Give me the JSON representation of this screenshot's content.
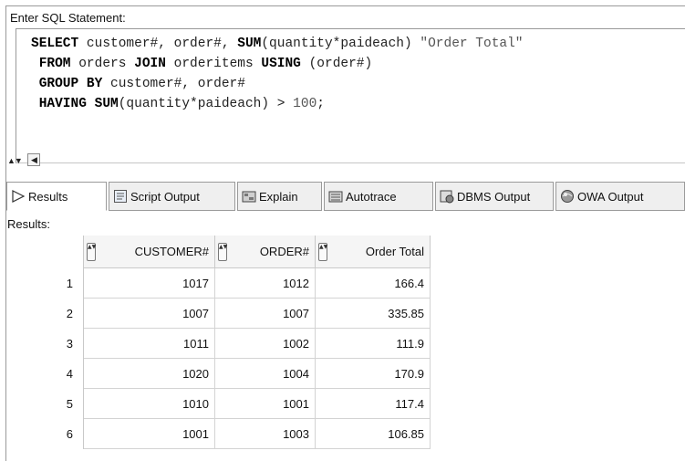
{
  "sql_panel": {
    "label": "Enter SQL Statement:",
    "lines": [
      [
        {
          "t": "SELECT",
          "k": 1
        },
        {
          "t": " customer#, order#, "
        },
        {
          "t": "SUM",
          "k": 1
        },
        {
          "t": "(quantity*paideach) "
        },
        {
          "t": "\"Order Total\"",
          "s": 1
        }
      ],
      [
        {
          "t": " "
        },
        {
          "t": "FROM",
          "k": 1
        },
        {
          "t": " orders "
        },
        {
          "t": "JOIN",
          "k": 1
        },
        {
          "t": " orderitems "
        },
        {
          "t": "USING",
          "k": 1
        },
        {
          "t": " (order#)"
        }
      ],
      [
        {
          "t": " "
        },
        {
          "t": "GROUP BY",
          "k": 1
        },
        {
          "t": " customer#, order#"
        }
      ],
      [
        {
          "t": " "
        },
        {
          "t": "HAVING",
          "k": 1
        },
        {
          "t": " "
        },
        {
          "t": "SUM",
          "k": 1
        },
        {
          "t": "(quantity*paideach) > "
        },
        {
          "t": "100",
          "s": 1
        },
        {
          "t": ";"
        }
      ]
    ]
  },
  "tabs": [
    {
      "label": "Results",
      "icon": "results-triangle-icon",
      "active": true
    },
    {
      "label": "Script Output",
      "icon": "script-output-icon"
    },
    {
      "label": "Explain",
      "icon": "explain-icon"
    },
    {
      "label": "Autotrace",
      "icon": "autotrace-icon"
    },
    {
      "label": "DBMS Output",
      "icon": "dbms-output-icon"
    },
    {
      "label": "OWA Output",
      "icon": "owa-output-icon"
    }
  ],
  "results": {
    "label": "Results:",
    "columns": [
      "CUSTOMER#",
      "ORDER#",
      "Order Total"
    ],
    "rows": [
      [
        "1",
        "1017",
        "1012",
        "166.4"
      ],
      [
        "2",
        "1007",
        "1007",
        "335.85"
      ],
      [
        "3",
        "1011",
        "1002",
        "111.9"
      ],
      [
        "4",
        "1020",
        "1004",
        "170.9"
      ],
      [
        "5",
        "1010",
        "1001",
        "117.4"
      ],
      [
        "6",
        "1001",
        "1003",
        "106.85"
      ]
    ]
  }
}
